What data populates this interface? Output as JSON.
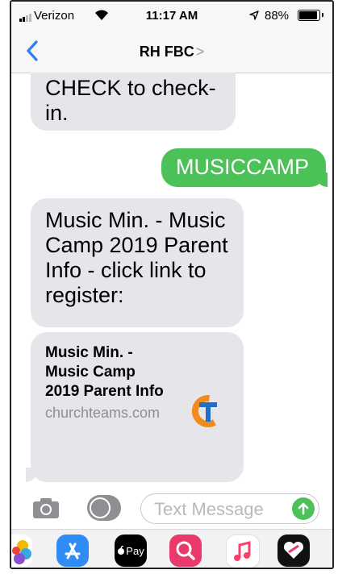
{
  "status_bar": {
    "carrier": "Verizon",
    "time": "11:17 AM",
    "battery": "88%",
    "battery_level": 0.88
  },
  "nav": {
    "title": "RH FBC",
    "chevron": ">"
  },
  "messages": [
    {
      "direction": "incoming",
      "text": "CHECK to check-in."
    },
    {
      "direction": "outgoing",
      "text": "MUSICCAMP"
    },
    {
      "direction": "incoming",
      "text": "Music Min. - Music Camp 2019 Parent Info  - click link to register:"
    }
  ],
  "link_preview": {
    "title": "Music Min. - Music Camp 2019 Parent Info",
    "domain": "churchteams.com"
  },
  "input_bar": {
    "placeholder": "Text Message"
  },
  "app_drawer": {
    "apple_pay_label": "Pay",
    "apps": [
      "photos-icon",
      "app-store-icon",
      "apple-pay-icon",
      "search-icon",
      "music-icon",
      "heart-icon"
    ]
  },
  "colors": {
    "outgoing_bubble": "#4cc158",
    "incoming_bubble": "#e6e5ea",
    "accent_blue": "#2f7cf6",
    "churchteams_orange": "#f28a1c"
  }
}
